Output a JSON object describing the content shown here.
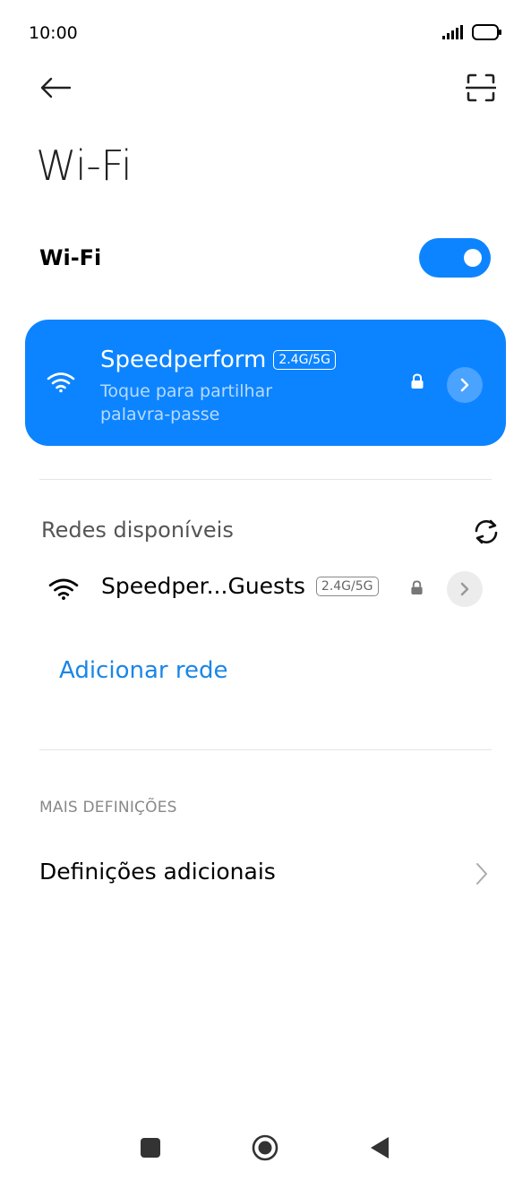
{
  "status_bar": {
    "time": "10:00",
    "icons": [
      "signal-icon",
      "battery-icon"
    ]
  },
  "header": {
    "back_icon": "arrow-left-icon",
    "scan_icon": "qr-scan-icon",
    "title": "Wi-Fi"
  },
  "wifi_toggle": {
    "label": "Wi-Fi",
    "enabled": true,
    "color": "#0d84ff"
  },
  "connected_network": {
    "name": "Speedperform",
    "band": "2.4G/5G",
    "subtitle": "Toque para partilhar palavra-passe",
    "secured": true,
    "card_color": "#0d84ff"
  },
  "available_networks": {
    "title": "Redes disponíveis",
    "refresh_icon": "refresh-icon",
    "items": [
      {
        "name": "Speedper...Guests",
        "band": "2.4G/5G",
        "secured": true
      }
    ]
  },
  "add_network": {
    "label": "Adicionar rede",
    "color": "#1a86e6"
  },
  "more_settings": {
    "header": "MAIS DEFINIÇÕES",
    "items": [
      {
        "label": "Definições adicionais"
      }
    ]
  },
  "nav_bar": {
    "icons": [
      "recents-square-icon",
      "home-circle-icon",
      "back-triangle-icon"
    ]
  }
}
